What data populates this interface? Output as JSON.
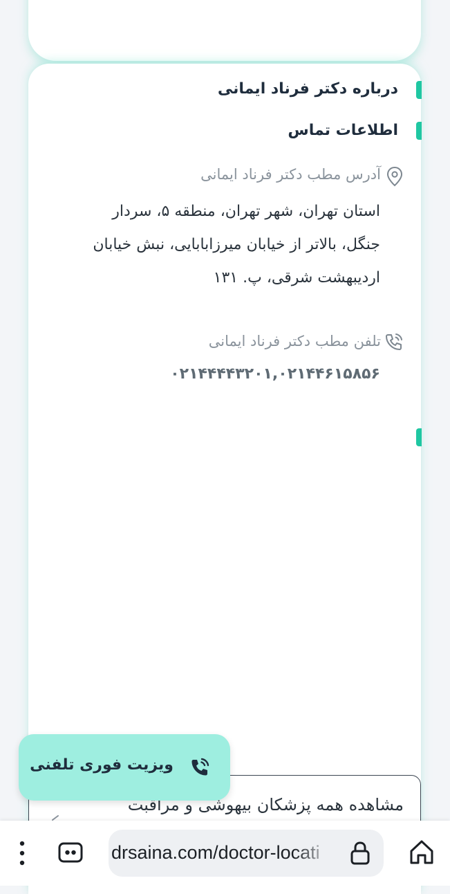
{
  "about": {
    "title": "درباره دکتر فرناد ایمانی"
  },
  "contact": {
    "title": "اطلاعات تماس",
    "address_label": "آدرس مطب دکتر فرناد ایمانی",
    "address": "استان تهران، شهر تهران، منطقه ۵، سردار جنگل، بالاتر از خیابان میرزابابایی، نبش خیابان اردیبهشت شرقی، پ. ۱۳۱",
    "phone_label": "تلفن مطب دکتر فرناد ایمانی",
    "phone": "۰۲۱۴۴۴۴۳۲۰۱,۰۲۱۴۴۶۱۵۸۵۶"
  },
  "view_all": {
    "label": "مشاهده همه پزشکان بیهوشی و مراقبت"
  },
  "fab": {
    "label": "ویزیت فوری تلفنی"
  },
  "browser": {
    "url": "drsaina.com/doctor-locati"
  },
  "colors": {
    "accent": "#1fc7a2",
    "fab_bg": "#9eeee0"
  },
  "icons": [
    "location-pin-icon",
    "phone-ringing-icon",
    "home-icon",
    "lock-icon",
    "tabs-icon",
    "more-vert-icon",
    "chevron-icon"
  ]
}
